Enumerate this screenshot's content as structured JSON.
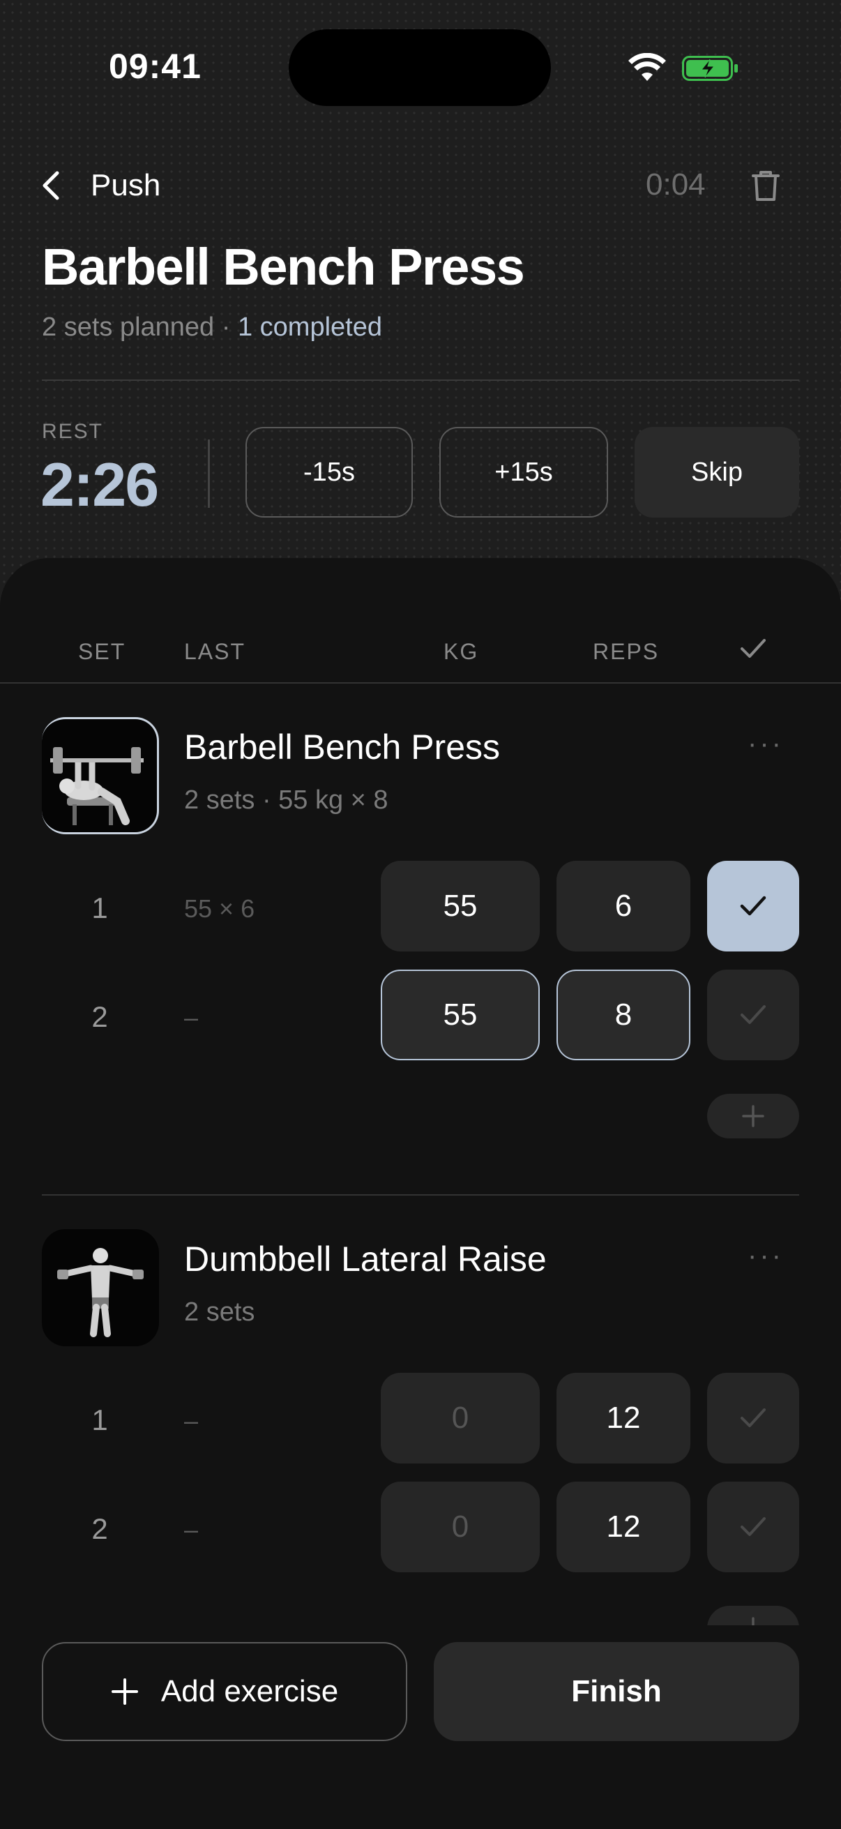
{
  "status_bar": {
    "time": "09:41"
  },
  "header": {
    "back_label": "Push",
    "elapsed": "0:04",
    "title": "Barbell Bench Press",
    "subtitle_planned": "2 sets planned · ",
    "subtitle_completed": "1 completed"
  },
  "rest": {
    "label": "REST",
    "time": "2:26",
    "minus_label": "-15s",
    "plus_label": "+15s",
    "skip_label": "Skip"
  },
  "columns": {
    "set": "SET",
    "last": "LAST",
    "kg": "KG",
    "reps": "REPS"
  },
  "exercises": [
    {
      "name": "Barbell Bench Press",
      "meta": "2 sets · 55 kg × 8",
      "more": "···",
      "sets": [
        {
          "num": "1",
          "last": "55 × 6",
          "kg": "55",
          "reps": "6",
          "done": true
        },
        {
          "num": "2",
          "last": "–",
          "kg": "55",
          "reps": "8",
          "done": false
        }
      ]
    },
    {
      "name": "Dumbbell Lateral Raise",
      "meta": "2 sets",
      "more": "···",
      "sets": [
        {
          "num": "1",
          "last": "–",
          "kg": "0",
          "reps": "12",
          "done": false
        },
        {
          "num": "2",
          "last": "–",
          "kg": "0",
          "reps": "12",
          "done": false
        }
      ]
    }
  ],
  "footer": {
    "add_label": "Add exercise",
    "finish_label": "Finish"
  },
  "colors": {
    "accent": "#b6c5d8",
    "background": "#121212",
    "surface": "#262626"
  }
}
